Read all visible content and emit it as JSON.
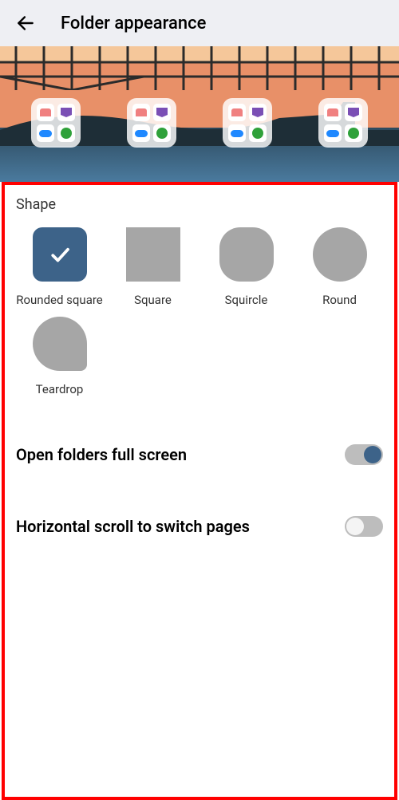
{
  "header": {
    "title": "Folder appearance"
  },
  "shape": {
    "section_label": "Shape",
    "options": [
      {
        "label": "Rounded square",
        "selected": true
      },
      {
        "label": "Square",
        "selected": false
      },
      {
        "label": "Squircle",
        "selected": false
      },
      {
        "label": "Round",
        "selected": false
      },
      {
        "label": "Teardrop",
        "selected": false
      }
    ]
  },
  "settings": {
    "open_full_screen": {
      "label": "Open folders full screen",
      "value": true
    },
    "horizontal_scroll": {
      "label": "Horizontal scroll to switch pages",
      "value": false
    }
  },
  "colors": {
    "accent": "#3d6389",
    "swatch_grey": "#a6a6a6"
  }
}
